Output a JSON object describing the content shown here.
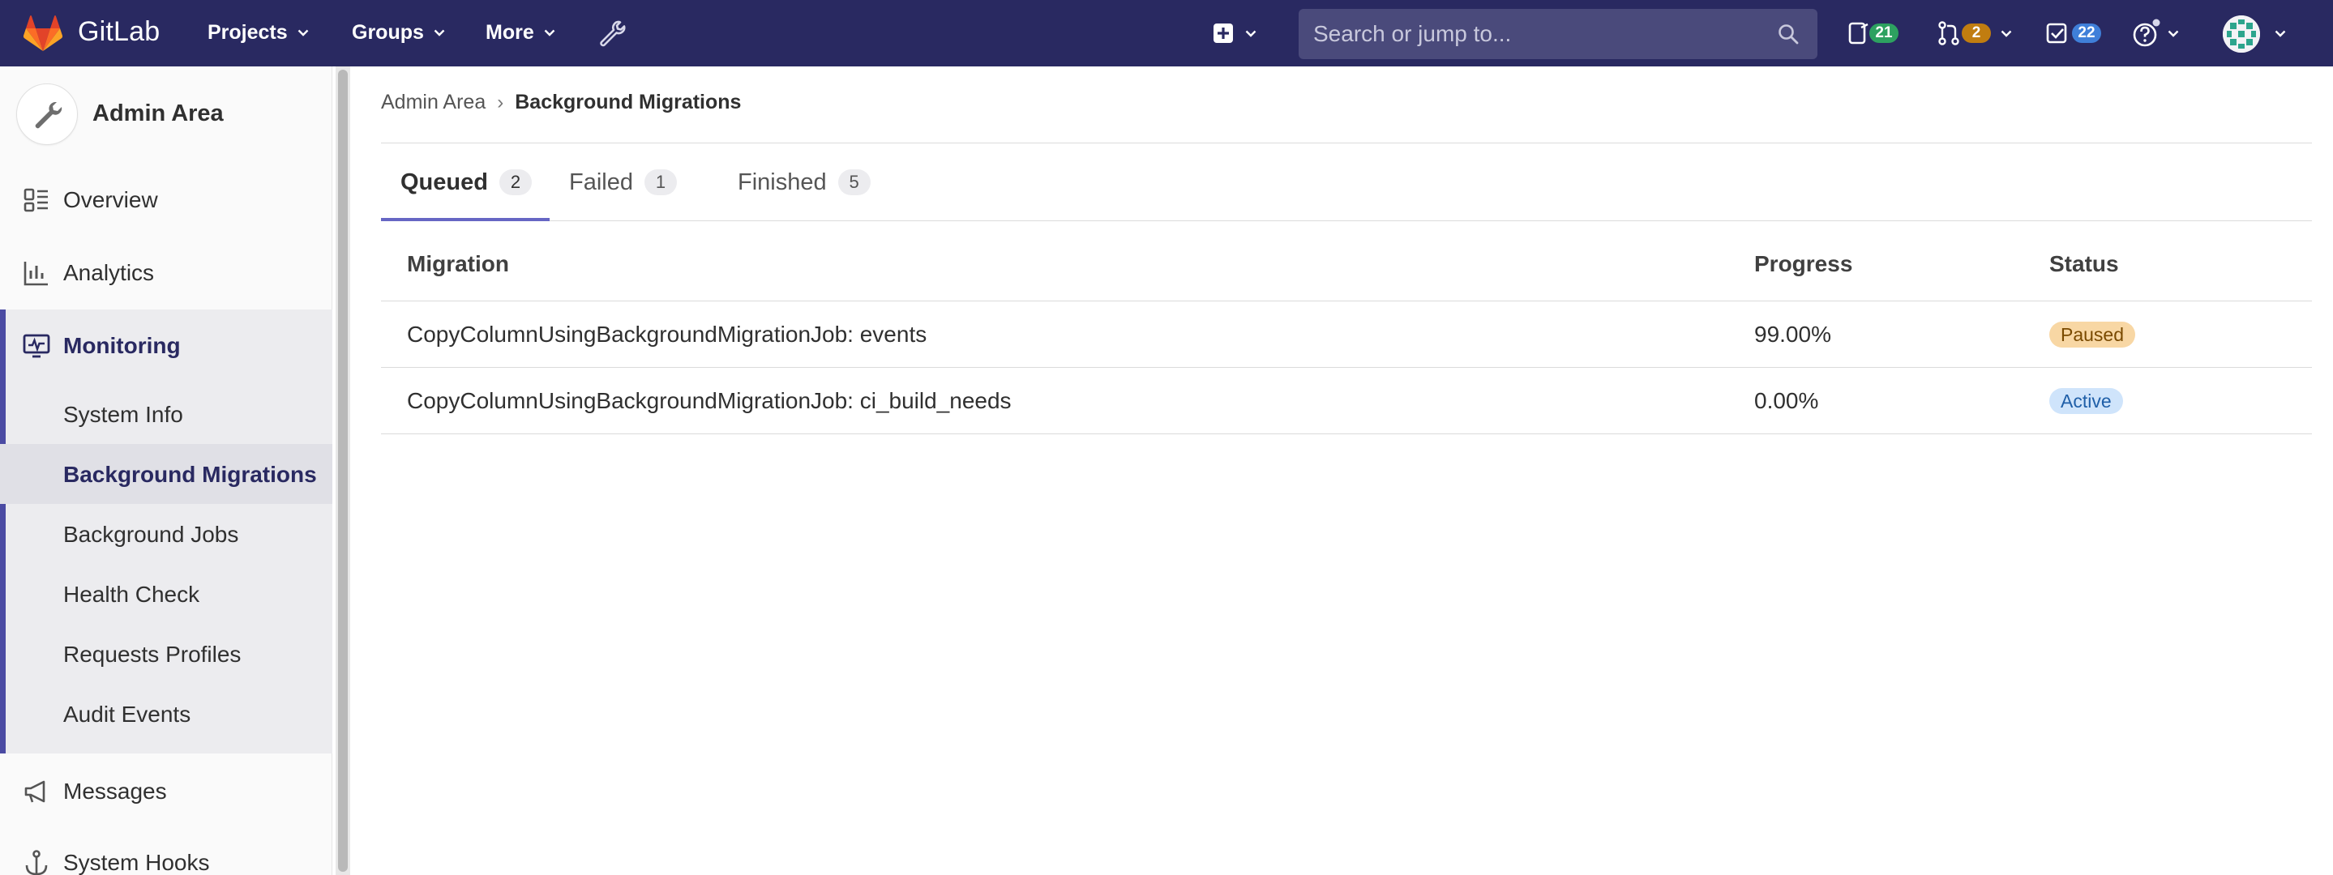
{
  "navbar": {
    "brand": "GitLab",
    "menus": [
      {
        "label": "Projects"
      },
      {
        "label": "Groups"
      },
      {
        "label": "More"
      }
    ],
    "search_placeholder": "Search or jump to...",
    "issues_count": "21",
    "merge_requests_count": "2",
    "todos_count": "22",
    "colors": {
      "navbar_bg": "#292961",
      "issues_badge": "#2da160",
      "mr_badge": "#c17d10",
      "todo_badge": "#3f7fd9"
    }
  },
  "sidebar": {
    "context_title": "Admin Area",
    "items": [
      {
        "label": "Overview",
        "icon": "overview-icon"
      },
      {
        "label": "Analytics",
        "icon": "analytics-icon"
      },
      {
        "label": "Monitoring",
        "icon": "monitor-icon"
      }
    ],
    "monitoring_sub": [
      {
        "label": "System Info"
      },
      {
        "label": "Background Migrations"
      },
      {
        "label": "Background Jobs"
      },
      {
        "label": "Health Check"
      },
      {
        "label": "Requests Profiles"
      },
      {
        "label": "Audit Events"
      }
    ],
    "more_items": [
      {
        "label": "Messages",
        "icon": "megaphone-icon"
      },
      {
        "label": "System Hooks",
        "icon": "anchor-icon"
      }
    ]
  },
  "breadcrumb": {
    "parent": "Admin Area",
    "separator": "›",
    "current": "Background Migrations"
  },
  "tabs": [
    {
      "label": "Queued",
      "count": "2",
      "active": true
    },
    {
      "label": "Failed",
      "count": "1",
      "active": false
    },
    {
      "label": "Finished",
      "count": "5",
      "active": false
    }
  ],
  "table": {
    "headers": {
      "migration": "Migration",
      "progress": "Progress",
      "status": "Status"
    },
    "rows": [
      {
        "migration": "CopyColumnUsingBackgroundMigrationJob: events",
        "progress": "99.00%",
        "status": "Paused"
      },
      {
        "migration": "CopyColumnUsingBackgroundMigrationJob: ci_build_needs",
        "progress": "0.00%",
        "status": "Active"
      }
    ]
  }
}
